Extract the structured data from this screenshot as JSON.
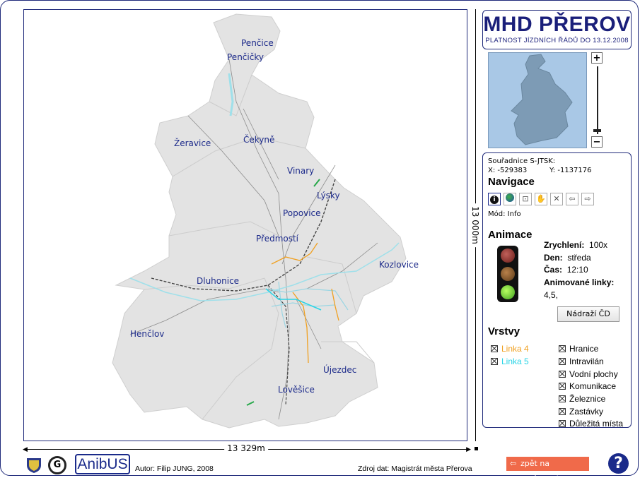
{
  "header": {
    "title": "MHD PŘEROV",
    "subtitle": "PLATNOST JÍZDNÍCH ŘÁDŮ DO 13.12.2008"
  },
  "map": {
    "places": [
      "Penčice",
      "Penčičky",
      "Žeravice",
      "Čekyně",
      "Vinary",
      "Lýsky",
      "Popovice",
      "Předmostí",
      "Kozlovice",
      "Dluhonice",
      "Henčlov",
      "Újezdec",
      "Lověšice"
    ],
    "scale_horizontal": "13 329m",
    "scale_vertical": "13 000m"
  },
  "coords": {
    "label": "Souřadnice S-JTSK:",
    "x_label": "X:",
    "x": "-529383",
    "y_label": "Y:",
    "y": "-1137176"
  },
  "navigation": {
    "title": "Navigace",
    "tools": [
      "info-icon",
      "globe-icon",
      "zoom-box-icon",
      "hand-icon",
      "full-extent-icon",
      "back-arrow-icon",
      "forward-arrow-icon"
    ],
    "mode_label": "Mód:",
    "mode": "Info"
  },
  "animation": {
    "title": "Animace",
    "speed_label": "Zrychlení:",
    "speed": "100x",
    "day_label": "Den:",
    "day": "středa",
    "time_label": "Čas:",
    "time": "12:10",
    "lines_label": "Animované linky:",
    "lines": "4,5,",
    "station_button": "Nádraží ČD"
  },
  "layers": {
    "title": "Vrstvy",
    "lines": [
      {
        "label": "Linka 4",
        "color": "#f0a020"
      },
      {
        "label": "Linka 5",
        "color": "#29d4e6"
      }
    ],
    "items": [
      "Hranice",
      "Intravilán",
      "Vodní plochy",
      "Komunikace",
      "Železnice",
      "Zastávky",
      "Důležitá místa"
    ]
  },
  "footer": {
    "logo_text": "AnibUS",
    "author": "Autor: Filip JUNG, 2008",
    "source": "Zdroj dat: Magistrát města Přerova",
    "back_button": "zpět na nastavení",
    "help": "?"
  },
  "colors": {
    "accent": "#1a1f7a",
    "map_area": "#e3e3e3",
    "overview_bg": "#a9c8e6",
    "overview_land": "#7d9bb5",
    "back_button": "#f06a4a"
  }
}
